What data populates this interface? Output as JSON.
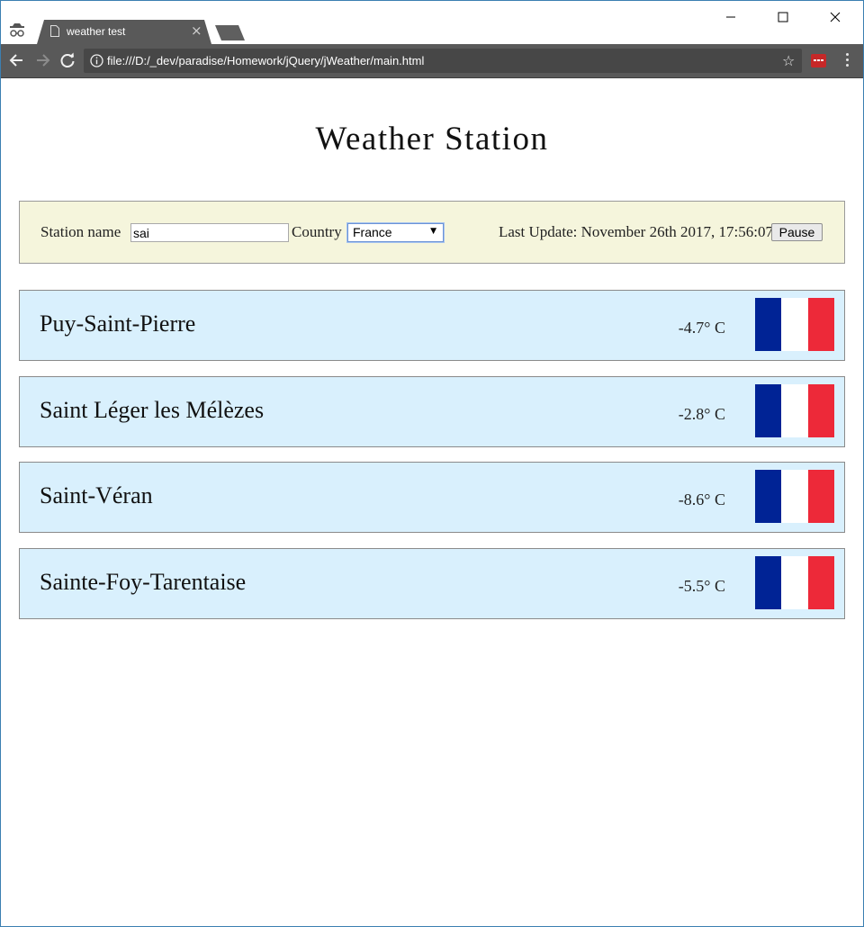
{
  "browser": {
    "tab_title": "weather test",
    "tab_close": "×",
    "url": "file:///D:/_dev/paradise/Homework/jQuery/jWeather/main.html",
    "star": "☆"
  },
  "page": {
    "title": "Weather Station",
    "controls": {
      "station_label": "Station name",
      "station_value": "sai",
      "country_label": "Country",
      "country_selected": "France",
      "last_update": "Last Update: November 26th 2017, 17:56:07",
      "pause_label": "Pause"
    },
    "stations": [
      {
        "name": "Puy-Saint-Pierre",
        "temp": "-4.7° C"
      },
      {
        "name": "Saint Léger les Mélèzes",
        "temp": "-2.8° C"
      },
      {
        "name": "Saint-Véran",
        "temp": "-8.6° C"
      },
      {
        "name": "Sainte-Foy-Tarentaise",
        "temp": "-5.5° C"
      }
    ]
  },
  "colors": {
    "controls_bg": "#f5f5dc",
    "station_bg": "#d9f0fd",
    "flag_blue": "#002395",
    "flag_white": "#ffffff",
    "flag_red": "#ed2939"
  }
}
